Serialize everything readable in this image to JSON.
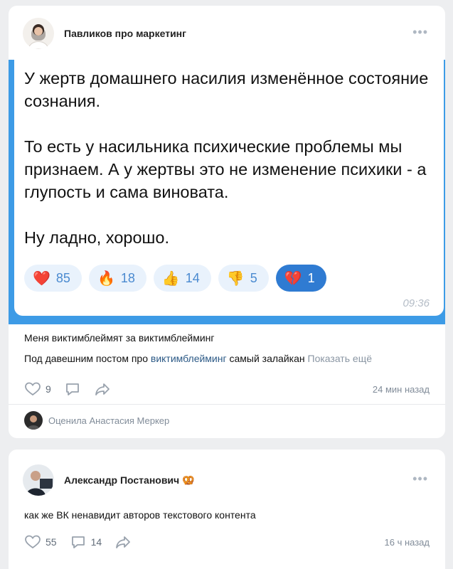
{
  "post1": {
    "author": "Павликов про маркетинг",
    "more": "•••",
    "quote": {
      "paragraph1": "У жертв домашнего насилия изменённое состояние сознания.",
      "paragraph2": "То есть у насильника психические проблемы мы признаем. А у жертвы это не изменение психики - а глупость и сама виновата.",
      "paragraph3": "Ну ладно, хорошо.",
      "time": "09:36",
      "reactions": [
        {
          "emoji": "❤️",
          "icon": "red-heart-icon",
          "count": "85"
        },
        {
          "emoji": "🔥",
          "icon": "fire-icon",
          "count": "18"
        },
        {
          "emoji": "👍",
          "icon": "thumbs-up-icon",
          "count": "14"
        },
        {
          "emoji": "👎",
          "icon": "thumbs-down-icon",
          "count": "5"
        },
        {
          "emoji": "💔",
          "icon": "broken-heart-icon",
          "count": "1"
        }
      ]
    },
    "title": "Меня виктимблеймят за виктимблейминг",
    "body_start": "Под давешним постом про ",
    "body_link": "виктимблейминг",
    "body_rest": " самый залайкан",
    "show_more": "Показать ещё",
    "likes": "9",
    "comments": "",
    "time_ago": "24 мин назад",
    "liked_by": "Оценила Анастасия Меркер"
  },
  "post2": {
    "author": "Александр Постанович",
    "badge_emoji": "🥨",
    "more": "•••",
    "text": "как же ВК ненавидит авторов текстового контента",
    "likes": "55",
    "comments": "14",
    "time_ago": "16 ч назад"
  },
  "colors": {
    "accent": "#2a5885",
    "telegram_blue": "#3d9be6",
    "reaction_bg": "#e9f2fc",
    "reaction_active": "#2f7bd2"
  }
}
